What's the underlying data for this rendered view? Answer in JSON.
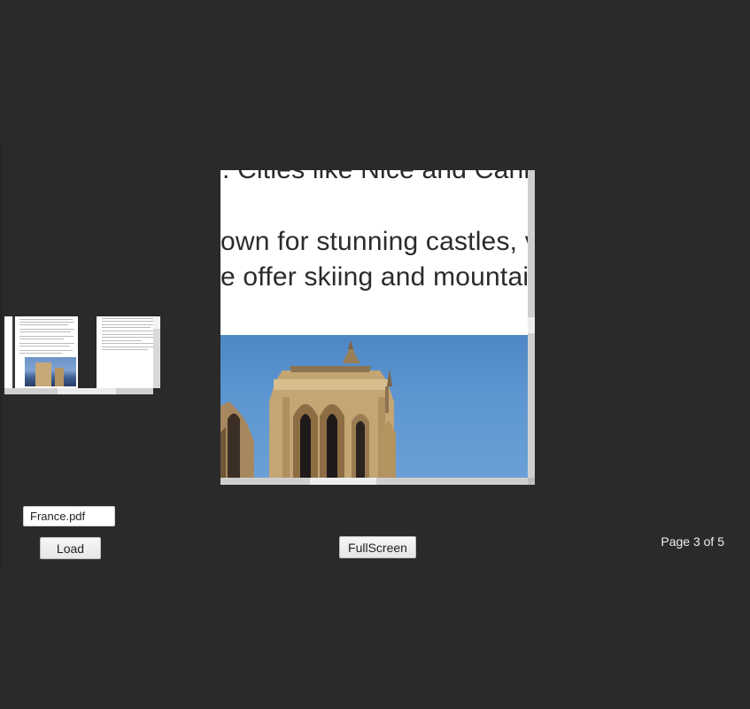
{
  "viewer": {
    "visible_text_lines": [
      ". Cities like Nice and Cann",
      "own for stunning castles, v",
      "e offer skiing and mountair"
    ]
  },
  "controls": {
    "file_name": "France.pdf",
    "load_label": "Load",
    "fullscreen_label": "FullScreen"
  },
  "status": {
    "page_text": "Page 3 of 5"
  },
  "colors": {
    "background": "#2a2a2a",
    "page": "#ffffff",
    "text": "#2b2b2b",
    "status_text": "#f0f0f0"
  }
}
